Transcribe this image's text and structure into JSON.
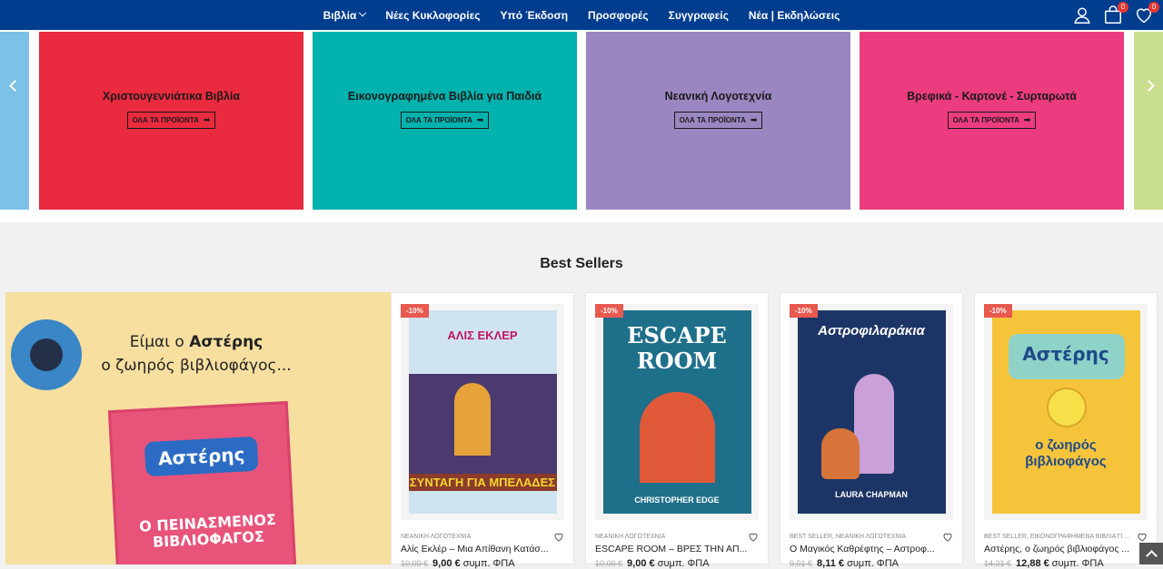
{
  "nav": {
    "items": [
      {
        "label": "Βιβλία",
        "has_dropdown": true
      },
      {
        "label": "Νέες Κυκλοφορίες"
      },
      {
        "label": "Υπό Έκδοση"
      },
      {
        "label": "Προσφορές"
      },
      {
        "label": "Συγγραφείς"
      },
      {
        "label": "Νέα | Εκδηλώσεις"
      }
    ],
    "cart_count": "0",
    "wishlist_count": "0"
  },
  "categories": [
    {
      "title": "Χριστουγεννιάτικα Βιβλία",
      "button": "ΟΛΑ ΤΑ ΠΡΟΪΟΝΤΑ",
      "color": "#ea2a3e"
    },
    {
      "title": "Εικονογραφημένα Βιβλία για Παιδιά",
      "button": "ΟΛΑ ΤΑ ΠΡΟΪΟΝΤΑ",
      "color": "#00b2ad"
    },
    {
      "title": "Νεανική Λογοτεχνία",
      "button": "ΟΛΑ ΤΑ ΠΡΟΪΟΝΤΑ",
      "color": "#9a87c1"
    },
    {
      "title": "Βρεφικά - Καρτονέ - Συρταρωτά",
      "button": "ΟΛΑ ΤΑ ΠΡΟΪΟΝΤΑ",
      "color": "#ec3c7f"
    }
  ],
  "best_sellers": {
    "title": "Best Sellers",
    "promo": {
      "line1": "Είμαι ο",
      "name": "Αστέρης",
      "line2": "ο ζωηρός βιβλιοφάγος...",
      "book_title": "Αστέρης",
      "book_subtitle": "Ο ΠΕΙΝΑΣΜΕΝΟΣ ΒΙΒΛΙΟΦΑΓΟΣ"
    },
    "products": [
      {
        "badge": "-10%",
        "category": "ΝΕΑΝΙΚΗ ΛΟΓΟΤΕΧΝΙΑ",
        "title": "Αλίς Εκλέρ – Μια Απίθανη Κατάσ...",
        "old_price": "10,00 €",
        "price": "9,00 €",
        "tax": "συμπ. ΦΠΑ",
        "cover_title": "ΣΥΝΤΑΓΗ ΓΙΑ ΜΠΕΛΑΔΕΣ",
        "cover_top": "ΑΛΙΣ ΕΚΛΕΡ",
        "cover_color": "#d9e7f2"
      },
      {
        "badge": "-10%",
        "category": "ΝΕΑΝΙΚΗ ΛΟΓΟΤΕΧΝΙΑ",
        "title": "ESCAPE ROOM – ΒΡΕΣ ΤΗΝ ΑΠ...",
        "old_price": "10,00 €",
        "price": "9,00 €",
        "tax": "συμπ. ΦΠΑ",
        "cover_title": "ESCAPE ROOM",
        "cover_top": "CHRISTOPHER EDGE",
        "cover_color": "#1e6f8a"
      },
      {
        "badge": "-10%",
        "category": "BEST SELLER, ΝΕΑΝΙΚΗ ΛΟΓΟΤΕΧΝΙΑ",
        "title": "Ο Μαγικός Καθρέφτης – Αστροφ...",
        "old_price": "9,01 €",
        "price": "8,11 €",
        "tax": "συμπ. ΦΠΑ",
        "cover_title": "Αστροφιλαράκια",
        "cover_top": "LAURA CHAPMAN",
        "cover_color": "#1d3566"
      },
      {
        "badge": "-10%",
        "category": "BEST SELLER, ΕΙΚΟΝΟΓΡΑΦΗΜΕΝΑ ΒΙΒΛΙΑ ΓΙΑ...",
        "title": "Αστέρης, ο ζωηρός βιβλιοφάγος ...",
        "old_price": "14,31 €",
        "price": "12,88 €",
        "tax": "συμπ. ΦΠΑ",
        "cover_title": "ο ζωηρός βιβλιοφάγος",
        "cover_top": "Αστέρης",
        "cover_color": "#f5c43a"
      }
    ]
  }
}
